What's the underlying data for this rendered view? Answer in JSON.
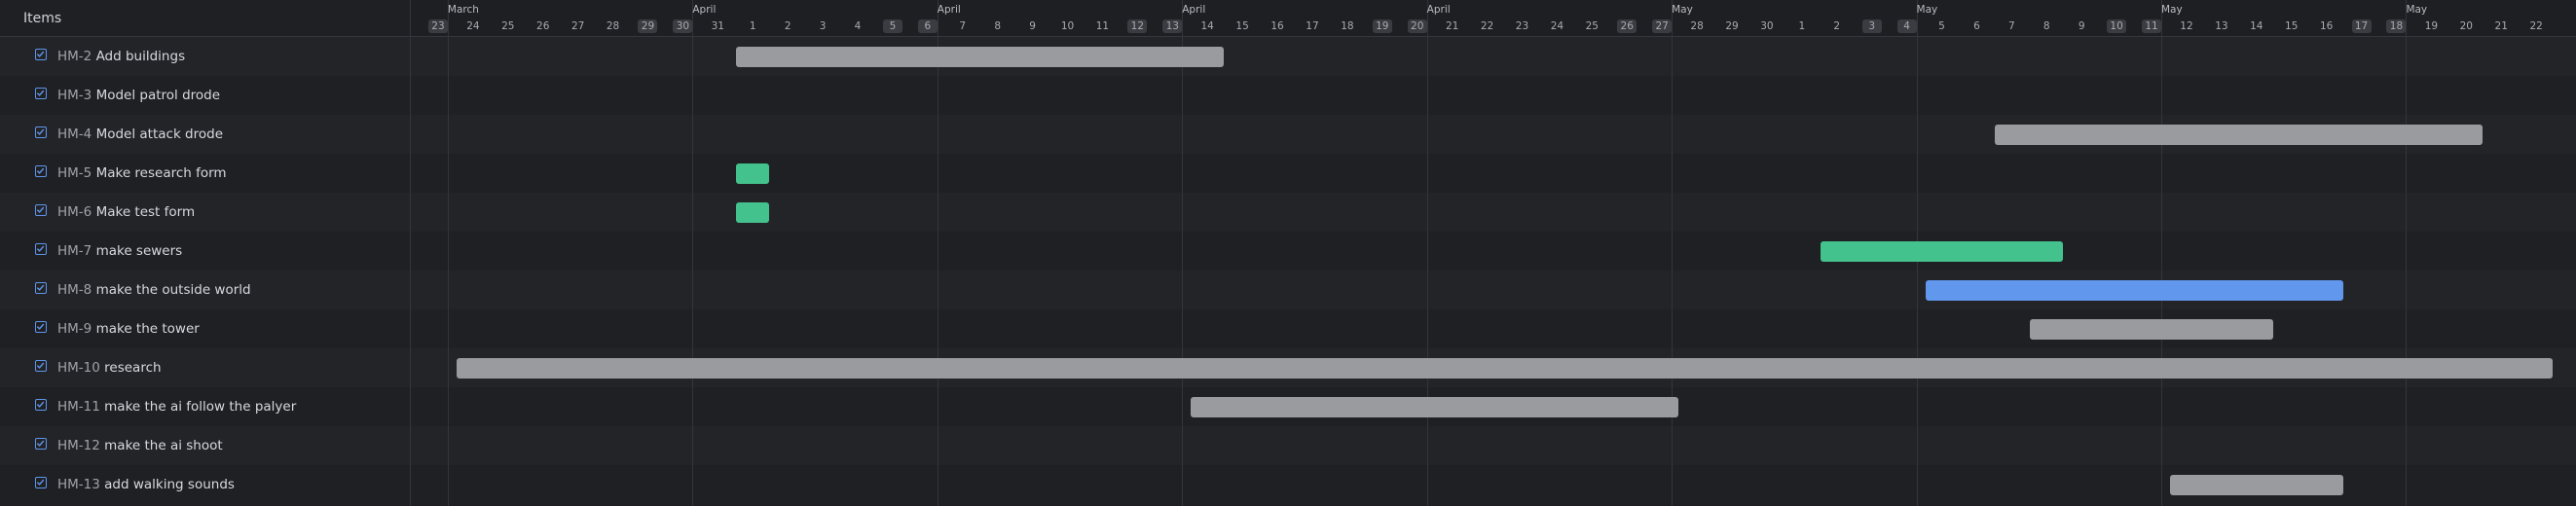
{
  "panel": {
    "items_label": "Items"
  },
  "colors": {
    "bar_default": "#9a9b9f",
    "bar_green": "#44c28d",
    "bar_blue": "#6297ee",
    "checkbox": "#5e95ea"
  },
  "timeline": {
    "start_date": "2024-03-23",
    "month_labels": [
      {
        "label": "March",
        "at": "2024-03-24"
      },
      {
        "label": "April",
        "at": "2024-03-31"
      },
      {
        "label": "April",
        "at": "2024-04-07"
      },
      {
        "label": "April",
        "at": "2024-04-14"
      },
      {
        "label": "April",
        "at": "2024-04-21"
      },
      {
        "label": "May",
        "at": "2024-04-28"
      },
      {
        "label": "May",
        "at": "2024-05-05"
      },
      {
        "label": "May",
        "at": "2024-05-12"
      },
      {
        "label": "May",
        "at": "2024-05-19"
      }
    ],
    "days": [
      "23",
      "24",
      "25",
      "26",
      "27",
      "28",
      "29",
      "30",
      "31",
      "1",
      "2",
      "3",
      "4",
      "5",
      "6",
      "7",
      "8",
      "9",
      "10",
      "11",
      "12",
      "13",
      "14",
      "15",
      "16",
      "17",
      "18",
      "19",
      "20",
      "21",
      "22",
      "23",
      "24",
      "25",
      "26",
      "27",
      "28",
      "29",
      "30",
      "1",
      "2",
      "3",
      "4",
      "5",
      "6",
      "7",
      "8",
      "9",
      "10",
      "11",
      "12",
      "13",
      "14",
      "15",
      "16",
      "17",
      "18",
      "19",
      "20",
      "21",
      "22"
    ],
    "weekend_dates": [
      "2024-03-23",
      "2024-03-29",
      "2024-03-30",
      "2024-04-05",
      "2024-04-06",
      "2024-04-12",
      "2024-04-13",
      "2024-04-19",
      "2024-04-20",
      "2024-04-26",
      "2024-04-27",
      "2024-05-03",
      "2024-05-04",
      "2024-05-10",
      "2024-05-11",
      "2024-05-17",
      "2024-05-18"
    ]
  },
  "items": [
    {
      "key": "HM-2",
      "title": "Add buildings",
      "checked": true,
      "bar": {
        "start": "2024-04-01",
        "end": "2024-04-14",
        "color": "gray"
      }
    },
    {
      "key": "HM-3",
      "title": "Model patrol drode",
      "checked": true,
      "bar": null
    },
    {
      "key": "HM-4",
      "title": "Model attack drode",
      "checked": true,
      "bar": {
        "start": "2024-05-07",
        "end": "2024-05-20",
        "color": "gray"
      }
    },
    {
      "key": "HM-5",
      "title": "Make research form",
      "checked": true,
      "bar": {
        "start": "2024-04-01",
        "end": "2024-04-01",
        "color": "green"
      }
    },
    {
      "key": "HM-6",
      "title": "Make test form",
      "checked": true,
      "bar": {
        "start": "2024-04-01",
        "end": "2024-04-01",
        "color": "green"
      }
    },
    {
      "key": "HM-7",
      "title": "make sewers",
      "checked": true,
      "bar": {
        "start": "2024-05-02",
        "end": "2024-05-08",
        "color": "green"
      }
    },
    {
      "key": "HM-8",
      "title": "make the outside world",
      "checked": true,
      "bar": {
        "start": "2024-05-05",
        "end": "2024-05-16",
        "color": "blue"
      }
    },
    {
      "key": "HM-9",
      "title": "make the tower",
      "checked": true,
      "bar": {
        "start": "2024-05-08",
        "end": "2024-05-14",
        "color": "gray"
      }
    },
    {
      "key": "HM-10",
      "title": "research",
      "checked": true,
      "bar": {
        "start": "2024-03-24",
        "end": "2024-05-22",
        "color": "gray"
      }
    },
    {
      "key": "HM-11",
      "title": "make the ai follow the palyer",
      "checked": true,
      "bar": {
        "start": "2024-04-14",
        "end": "2024-04-27",
        "color": "gray"
      }
    },
    {
      "key": "HM-12",
      "title": "make the ai shoot",
      "checked": true,
      "bar": null
    },
    {
      "key": "HM-13",
      "title": "add walking sounds",
      "checked": true,
      "bar": {
        "start": "2024-05-12",
        "end": "2024-05-16",
        "color": "gray"
      }
    }
  ]
}
